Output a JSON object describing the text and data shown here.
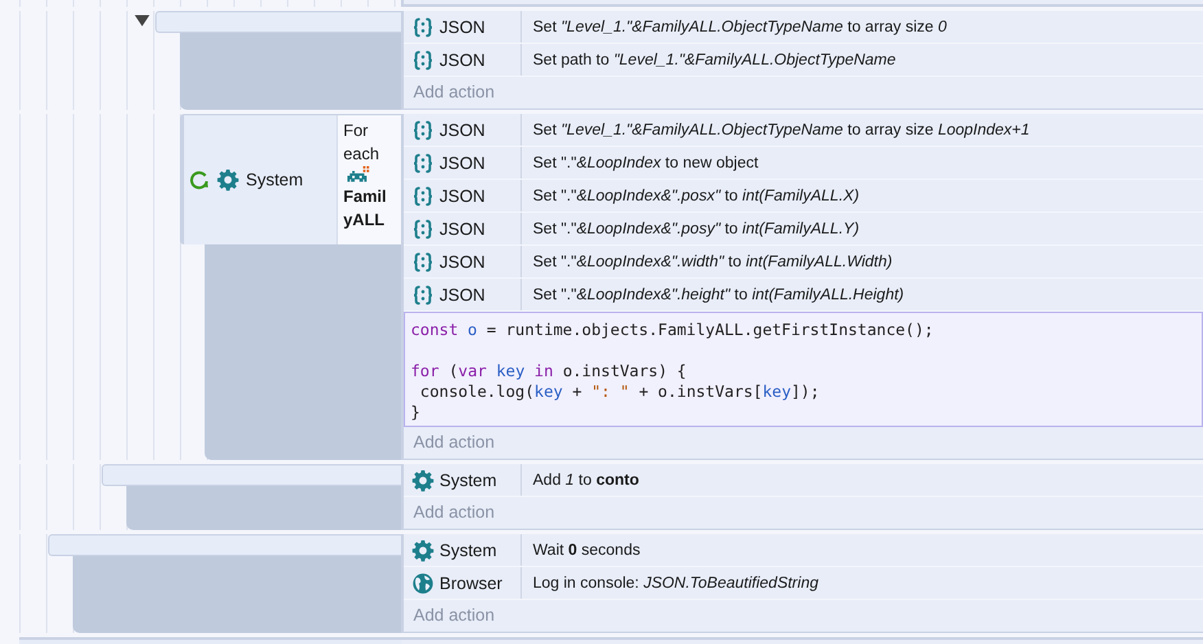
{
  "events": [
    {
      "expanded": true,
      "actions": [
        {
          "kind": "json",
          "object": "JSON",
          "text": "Set *\"Level_1.\"&FamilyALL.ObjectTypeName* to array size *0*"
        },
        {
          "kind": "json",
          "object": "JSON",
          "text": "Set path to *\"Level_1.\"&FamilyALL.ObjectTypeName*"
        }
      ],
      "add_action": "Add action"
    },
    {
      "conditions": [
        {
          "kind": "system_loop",
          "object": "System",
          "text": "For each",
          "target": "FamilyALL"
        }
      ],
      "actions": [
        {
          "kind": "json",
          "object": "JSON",
          "text": "Set *\"Level_1.\"&FamilyALL.ObjectTypeName* to array size *LoopIndex+1*"
        },
        {
          "kind": "json",
          "object": "JSON",
          "text": "Set \".\"*&LoopIndex* to new object"
        },
        {
          "kind": "json",
          "object": "JSON",
          "text": "Set \".\"*&LoopIndex&\".posx\"* to *int(FamilyALL.X)*"
        },
        {
          "kind": "json",
          "object": "JSON",
          "text": "Set \".\"*&LoopIndex&\".posy\"* to *int(FamilyALL.Y)*"
        },
        {
          "kind": "json",
          "object": "JSON",
          "text": "Set \".\"*&LoopIndex&\".width\"* to *int(FamilyALL.Width)*"
        },
        {
          "kind": "json",
          "object": "JSON",
          "text": "Set \".\"*&LoopIndex&\".height\"* to *int(FamilyALL.Height)*"
        },
        {
          "kind": "script",
          "paragraphs": [
            [
              [
                {
                  "kind": "keyword",
                  "text": "const "
                },
                {
                  "kind": "name",
                  "text": "o"
                },
                {
                  "kind": "plain",
                  "text": " = runtime.objects.FamilyALL.getFirstInstance();"
                }
              ]
            ],
            [
              [
                {
                  "kind": "keyword",
                  "text": "for"
                },
                {
                  "kind": "plain",
                  "text": " ("
                },
                {
                  "kind": "keyword",
                  "text": "var "
                },
                {
                  "kind": "name",
                  "text": "key"
                },
                {
                  "kind": "keyword",
                  "text": " in"
                },
                {
                  "kind": "plain",
                  "text": " o.instVars) {"
                }
              ],
              [
                {
                  "kind": "plain",
                  "text": " console.log("
                },
                {
                  "kind": "name",
                  "text": "key"
                },
                {
                  "kind": "plain",
                  "text": " + "
                },
                {
                  "kind": "string",
                  "text": "\": \""
                },
                {
                  "kind": "plain",
                  "text": " + o.instVars["
                },
                {
                  "kind": "name",
                  "text": "key"
                },
                {
                  "kind": "plain",
                  "text": "]);"
                }
              ],
              [
                {
                  "kind": "plain",
                  "text": "}"
                }
              ]
            ]
          ]
        }
      ],
      "add_action": "Add action"
    },
    {
      "actions": [
        {
          "kind": "system",
          "object": "System",
          "text": "Add *1* to **conto**"
        }
      ],
      "add_action": "Add action"
    },
    {
      "actions": [
        {
          "kind": "system",
          "object": "System",
          "text": "Wait **0** seconds"
        },
        {
          "kind": "browser",
          "object": "Browser",
          "text": "Log in console: *JSON.ToBeautifiedString*"
        }
      ],
      "add_action": "Add action"
    }
  ]
}
